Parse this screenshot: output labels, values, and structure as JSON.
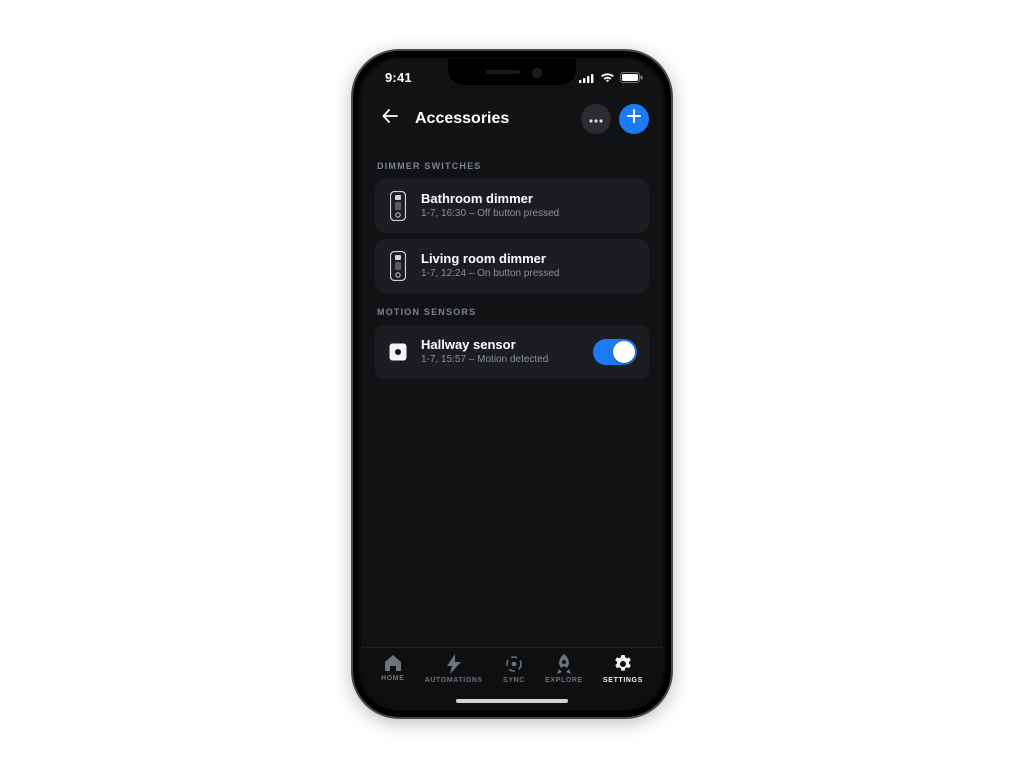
{
  "statusbar": {
    "time": "9:41"
  },
  "header": {
    "title": "Accessories"
  },
  "sections": {
    "dimmers": {
      "label": "DIMMER SWITCHES",
      "items": [
        {
          "title": "Bathroom dimmer",
          "subtitle": "1-7, 16:30 – Off button pressed"
        },
        {
          "title": "Living room dimmer",
          "subtitle": "1-7, 12:24 – On button pressed"
        }
      ]
    },
    "motion": {
      "label": "MOTION SENSORS",
      "items": [
        {
          "title": "Hallway sensor",
          "subtitle": "1-7, 15:57 – Motion detected",
          "enabled": true
        }
      ]
    }
  },
  "tabs": [
    {
      "label": "HOME"
    },
    {
      "label": "AUTOMATIONS"
    },
    {
      "label": "SYNC"
    },
    {
      "label": "EXPLORE"
    },
    {
      "label": "SETTINGS"
    }
  ]
}
